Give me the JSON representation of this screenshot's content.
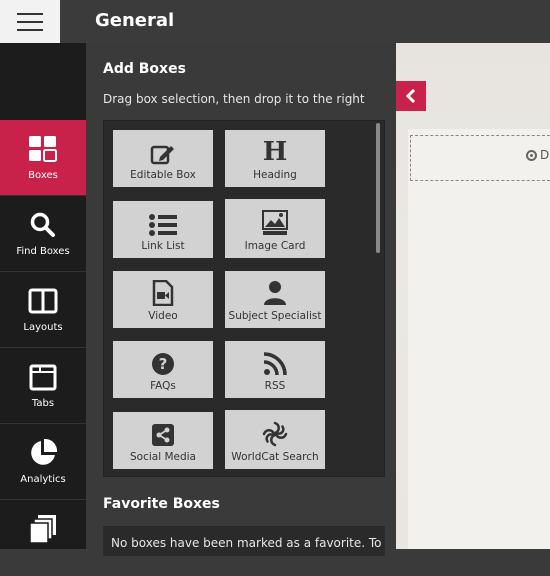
{
  "header": {
    "title": "General"
  },
  "rail": {
    "items": [
      {
        "label": "Boxes",
        "icon": "boxes-icon",
        "active": true
      },
      {
        "label": "Find Boxes",
        "icon": "search-icon"
      },
      {
        "label": "Layouts",
        "icon": "layouts-icon"
      },
      {
        "label": "Tabs",
        "icon": "tabs-icon"
      },
      {
        "label": "Analytics",
        "icon": "pie-chart-icon"
      },
      {
        "label": "",
        "icon": "copy-icon"
      }
    ]
  },
  "panel": {
    "title": "Add Boxes",
    "subtitle": "Drag box selection, then drop it to the right",
    "tiles": [
      {
        "label": "Editable Box",
        "icon": "edit-icon"
      },
      {
        "label": "Heading",
        "icon": "heading-icon",
        "glyph": "H"
      },
      {
        "label": "Link List",
        "icon": "list-icon"
      },
      {
        "label": "Image Card",
        "icon": "image-icon"
      },
      {
        "label": "Video",
        "icon": "video-icon"
      },
      {
        "label": "Subject Specialist",
        "icon": "user-icon"
      },
      {
        "label": "FAQs",
        "icon": "question-icon"
      },
      {
        "label": "RSS",
        "icon": "rss-icon"
      },
      {
        "label": "Social Media",
        "icon": "share-icon"
      },
      {
        "label": "WorldCat Search",
        "icon": "worldcat-icon"
      }
    ],
    "favorites_title": "Favorite Boxes",
    "favorites_text": "No boxes have been marked as a favorite. To"
  },
  "canvas": {
    "dropzone_letter": "D"
  },
  "colors": {
    "accent": "#c8224a",
    "rail": "#1c1c1c",
    "panel": "#3a3a3a",
    "tile": "#d2d2d2"
  }
}
